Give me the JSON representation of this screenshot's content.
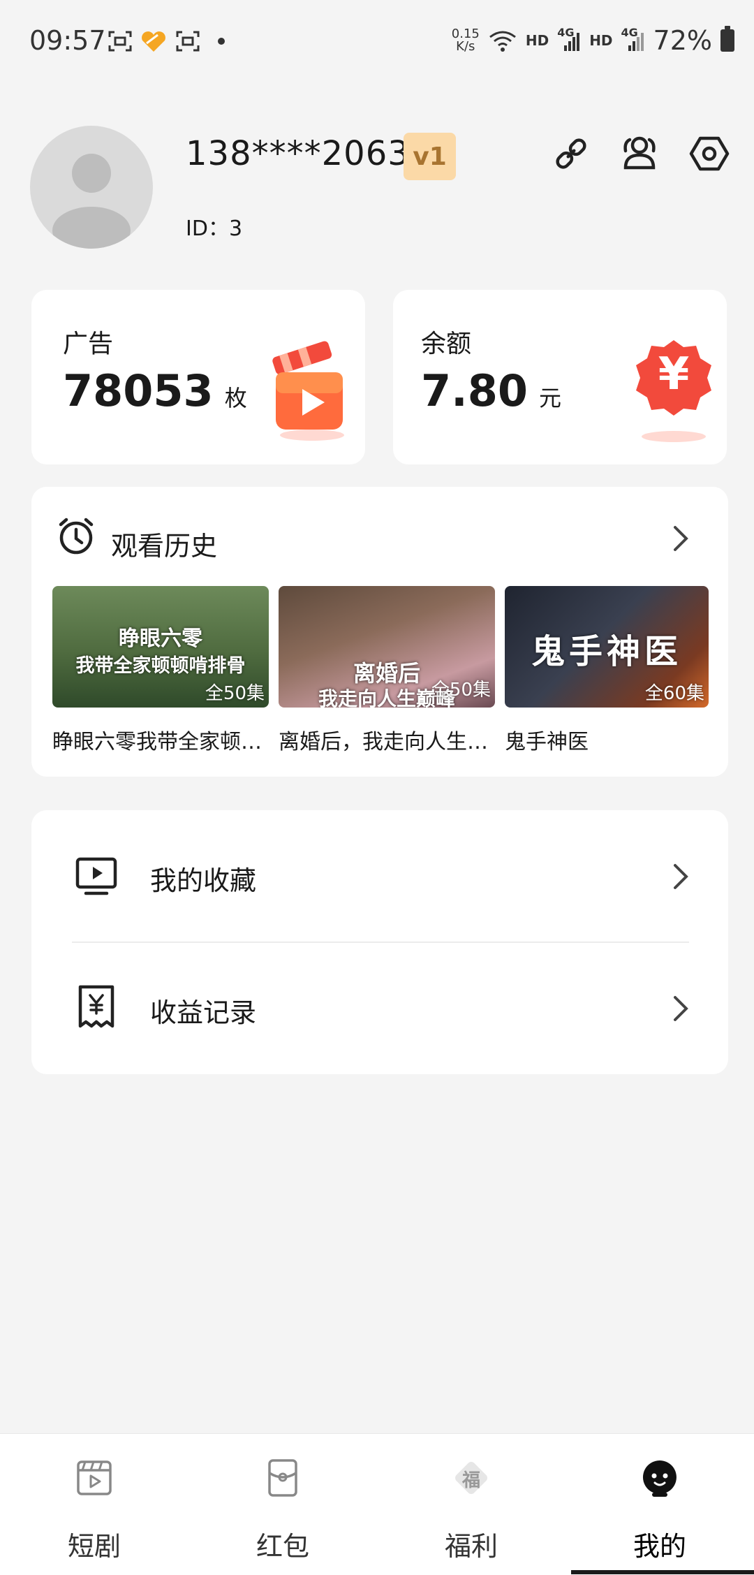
{
  "status_bar": {
    "time": "09:57",
    "net_speed_top": "0.15",
    "net_speed_unit": "K/s",
    "hd1": "HD",
    "hd2": "HD",
    "sig1": "4G",
    "sig2": "4G",
    "battery": "72%"
  },
  "profile": {
    "phone": "138****2063",
    "level": "v1",
    "id_text": "ID：3"
  },
  "stats": {
    "ads": {
      "label": "广告",
      "value": "78053",
      "unit": "枚"
    },
    "balance": {
      "label": "余额",
      "value": "7.80",
      "unit": "元",
      "currency_symbol": "¥"
    }
  },
  "history": {
    "title": "观看历史",
    "items": [
      {
        "caption": "睁眼六零我带全家顿…",
        "cover_line1": "睁眼六零",
        "cover_line2": "我带全家顿顿啃排骨",
        "episodes": "全50集"
      },
      {
        "caption": "离婚后，我走向人生…",
        "cover_line1": "离婚后",
        "cover_line2": "我走向人生巅峰",
        "episodes": "全50集"
      },
      {
        "caption": "鬼手神医",
        "cover_line1": "鬼手神医",
        "cover_line2": "",
        "episodes": "全60集"
      }
    ]
  },
  "menu": {
    "favorites": "我的收藏",
    "earnings": "收益记录"
  },
  "tabbar": {
    "tabs": [
      {
        "label": "短剧"
      },
      {
        "label": "红包"
      },
      {
        "label": "福利",
        "badge_char": "福"
      },
      {
        "label": "我的"
      }
    ]
  },
  "colors": {
    "vip_bg": "#fbd9a7",
    "vip_text": "#a87430",
    "accent_red": "#f24a3c",
    "accent_orange": "#ff7a3d"
  }
}
